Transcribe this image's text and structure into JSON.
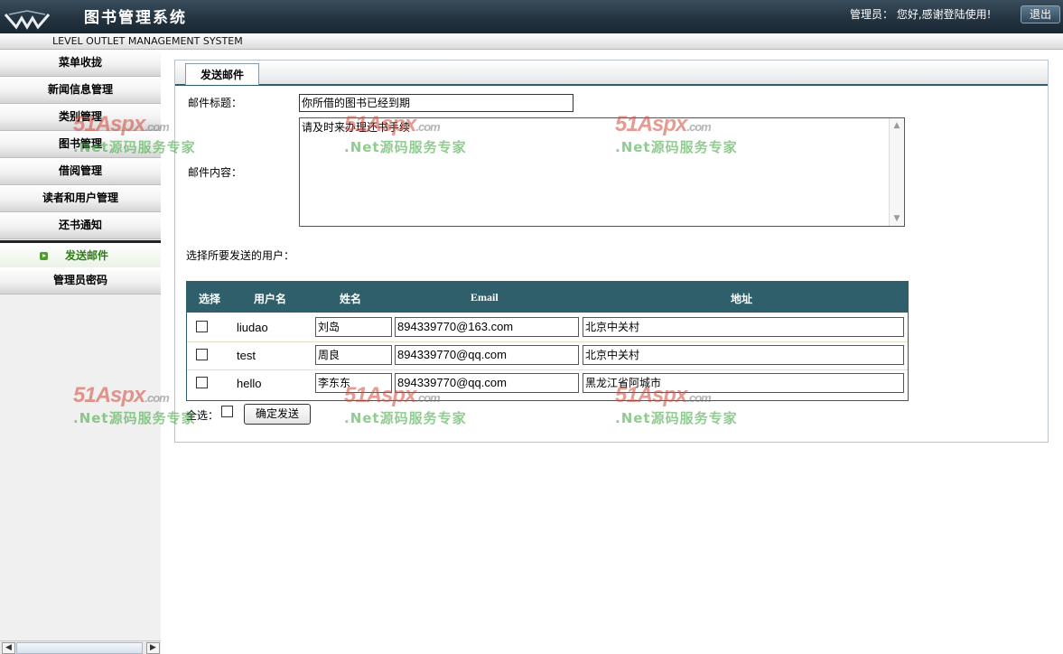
{
  "header": {
    "app_title": "图书管理系统",
    "subtitle": "LEVEL OUTLET MANAGEMENT SYSTEM",
    "admin_label": "管理员：",
    "greeting": "您好,感谢登陆使用!",
    "logout_label": "退出"
  },
  "sidebar": {
    "items": [
      {
        "label": "菜单收拢"
      },
      {
        "label": "新闻信息管理"
      },
      {
        "label": "类别管理"
      },
      {
        "label": "图书管理"
      },
      {
        "label": "借阅管理"
      },
      {
        "label": "读者和用户管理"
      },
      {
        "label": "还书通知"
      },
      {
        "label": "发送邮件",
        "active": true
      },
      {
        "label": "管理员密码"
      }
    ]
  },
  "tab": {
    "label": "发送邮件"
  },
  "form": {
    "subject_label": "邮件标题：",
    "subject_value": "你所借的图书已经到期",
    "content_label": "邮件内容：",
    "content_value": "请及时来办理还书手续",
    "select_users_label": "选择所要发送的用户：",
    "select_all_label": "全选：",
    "submit_label": "确定发送"
  },
  "users_table": {
    "columns": [
      "选择",
      "用户名",
      "姓名",
      "Email",
      "地址"
    ],
    "rows": [
      {
        "username": "liudao",
        "name": "刘岛",
        "email": "894339770@163.com",
        "address": "北京中关村"
      },
      {
        "username": "test",
        "name": "周良",
        "email": "894339770@qq.com",
        "address": "北京中关村"
      },
      {
        "username": "hello",
        "name": "李东东",
        "email": "894339770@qq.com",
        "address": "黑龙江省阿城市"
      }
    ]
  },
  "watermark": {
    "brand": "51Aspx",
    "domain": ".com",
    "slogan": ".Net源码服务专家"
  }
}
